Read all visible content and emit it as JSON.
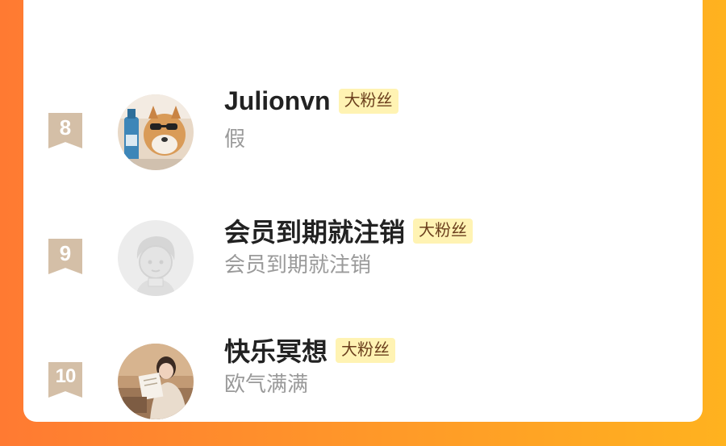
{
  "ranking": [
    {
      "rank": "8",
      "name": "Julionvn",
      "badge": "大粉丝",
      "subtitle": "假",
      "avatar": "dog-with-bottle-avatar"
    },
    {
      "rank": "9",
      "name": "会员到期就注销",
      "badge": "大粉丝",
      "subtitle": "会员到期就注销",
      "avatar": "default-cartoon-avatar"
    },
    {
      "rank": "10",
      "name": "快乐冥想",
      "badge": "大粉丝",
      "subtitle": "欧气满满",
      "avatar": "woman-reading-avatar"
    }
  ],
  "colors": {
    "background_start": "#ff7a32",
    "background_end": "#ffb21f",
    "card": "#ffffff",
    "rank_ribbon": "#d4bfa7",
    "badge_bg": "#fff3b3"
  }
}
